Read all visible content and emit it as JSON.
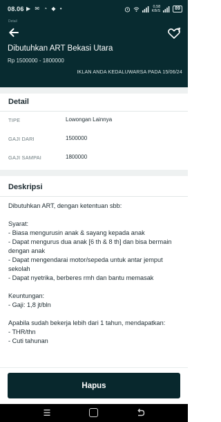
{
  "status_bar": {
    "time": "08.06",
    "left_icons": "▶ ✉ ◔ ◆ •",
    "data_top": "0,58",
    "data_bottom": "KB/S",
    "battery": "89"
  },
  "header": {
    "bar_label": "Detail",
    "title": "Dibutuhkan ART Bekasi Utara",
    "salary": "Rp 1500000 - 1800000",
    "expiry": "IKLAN ANDA KEDALUWARSA PADA 15/06/24"
  },
  "detail": {
    "heading": "Detail",
    "rows": [
      {
        "label": "TIPE",
        "value": "Lowongan Lainnya"
      },
      {
        "label": "GAJI DARI",
        "value": "1500000"
      },
      {
        "label": "GAJI SAMPAI",
        "value": "1800000"
      }
    ]
  },
  "description": {
    "heading": "Deskripsi",
    "lines": [
      "Dibutuhkan ART, dengan ketentuan sbb:",
      "",
      "Syarat:",
      "- Biasa mengurusin anak & sayang kepada anak",
      "- Dapat mengurus dua anak [6 th & 8 th] dan bisa bermain dengan anak",
      "- Dapat mengendarai motor/sepeda untuk antar jemput sekolah",
      "- Dapat nyetrika, berberes rmh dan bantu memasak",
      "",
      "Keuntungan:",
      "- Gaji: 1,8 jt/bln",
      "",
      "Apabila sudah bekerja lebih dari 1 tahun, mendapatkan:",
      "- THR/thn",
      "- Cuti tahunan"
    ]
  },
  "actions": {
    "delete_label": "Hapus"
  },
  "colors": {
    "header_bg": "#082b30",
    "button_bg": "#08282d",
    "divider": "#eef1f1"
  },
  "icons": [
    "back-arrow-icon",
    "heart-share-icon",
    "recents-icon",
    "home-icon",
    "back-nav-icon"
  ]
}
